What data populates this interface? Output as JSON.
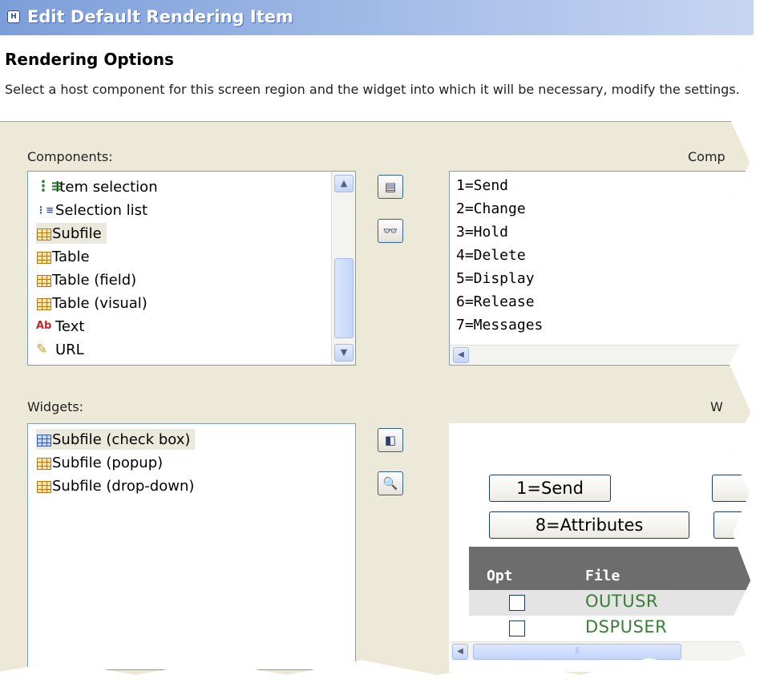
{
  "window": {
    "title": "Edit Default Rendering Item",
    "icon": "app-icon"
  },
  "header": {
    "title": "Rendering Options",
    "description": "Select a host component for this screen region and the widget into which it will be necessary, modify the settings."
  },
  "components": {
    "label": "Components:",
    "items": [
      {
        "label": "Item selection",
        "icon": "bulleted-list-icon"
      },
      {
        "label": "Selection list",
        "icon": "numbered-list-icon"
      },
      {
        "label": "Subfile",
        "icon": "table-icon",
        "selected": true
      },
      {
        "label": "Table",
        "icon": "table-icon"
      },
      {
        "label": "Table (field)",
        "icon": "table-icon"
      },
      {
        "label": "Table (visual)",
        "icon": "table-icon"
      },
      {
        "label": "Text",
        "icon": "text-icon"
      },
      {
        "label": "URL",
        "icon": "url-icon"
      }
    ]
  },
  "component_preview": {
    "label": "Comp",
    "items": [
      "1=Send",
      "2=Change",
      "3=Hold",
      "4=Delete",
      "5=Display",
      "6=Release",
      "7=Messages"
    ]
  },
  "widgets": {
    "label": "Widgets:",
    "items": [
      {
        "label": "Subfile (check box)",
        "icon": "table-icon",
        "selected": true
      },
      {
        "label": "Subfile (popup)",
        "icon": "table-icon"
      },
      {
        "label": "Subfile (drop-down)",
        "icon": "table-icon"
      }
    ]
  },
  "widget_preview": {
    "label": "W",
    "buttons": [
      "1=Send",
      "8=Attributes"
    ],
    "columns": [
      "Opt",
      "File"
    ],
    "rows": [
      {
        "value": "OUTUSR"
      },
      {
        "value": "DSPUSER"
      }
    ]
  },
  "toolbar_icons": {
    "components": [
      "settings-panel-icon",
      "glasses-settings-icon"
    ],
    "widgets": [
      "widget-settings-icon",
      "magnifier-icon"
    ]
  }
}
